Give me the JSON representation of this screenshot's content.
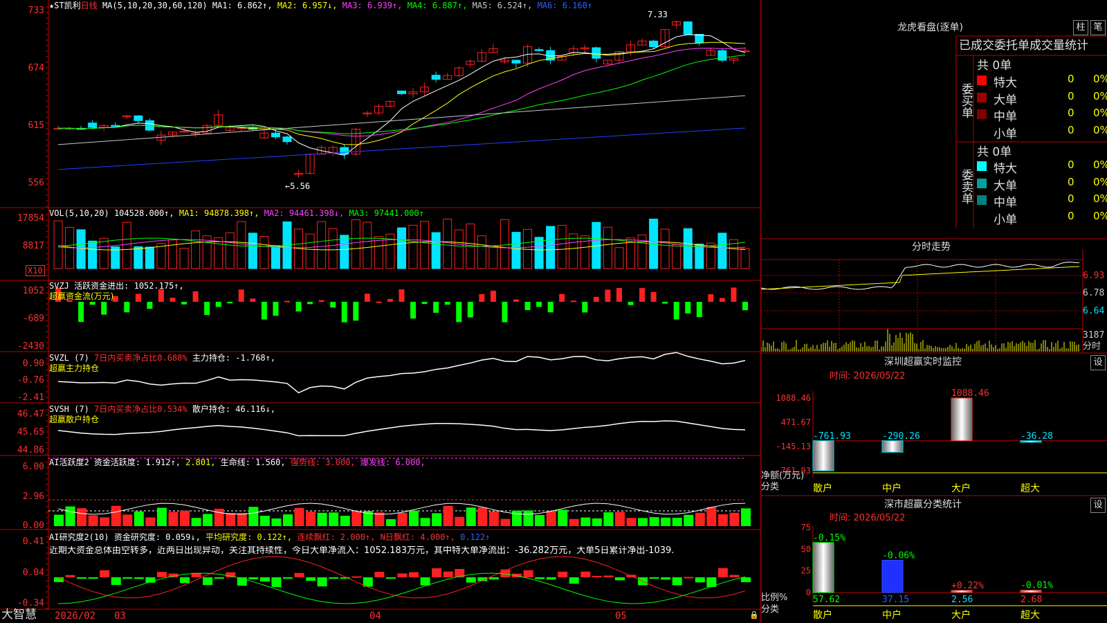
{
  "colors": {
    "up": "#ff2020",
    "down": "#00e5ff",
    "grid": "#b00000",
    "ma1": "#ffffff",
    "ma2": "#ffff00",
    "ma3": "#ff40ff",
    "ma4": "#00ff00",
    "ma5": "#c8c8c8",
    "ma6": "#2040ff"
  },
  "kline": {
    "header": {
      "name": "★ST凯利",
      "period": "日线",
      "ma_params": "MA(5,10,20,30,60,120)",
      "ma1": "MA1: 6.862↑,",
      "ma2": "MA2: 6.957↓,",
      "ma3": "MA3: 6.939↑,",
      "ma4": "MA4: 6.887↑,",
      "ma5": "MA5: 6.524↑,",
      "ma6": "MA6: 6.160↑"
    },
    "y_ticks": [
      "733",
      "674",
      "615",
      "556"
    ],
    "high_label": "7.33",
    "low_label": "←5.56"
  },
  "volume": {
    "header": {
      "title": "VOL(5,10,20)",
      "value": "104528.000↑,",
      "ma1": "MA1: 94878.398↑,",
      "ma2": "MA2: 94461.398↓,",
      "ma3": "MA3: 97441.000↑"
    },
    "y_ticks": [
      "17854",
      "8817"
    ],
    "unit": "X10"
  },
  "svzj": {
    "header": {
      "title": "SVZJ",
      "label": "活跃资金进出: 1052.175↑,",
      "sub": "超赢资金流(万元)"
    },
    "y_ticks": [
      "1052",
      "-689",
      "-2430"
    ]
  },
  "svzl": {
    "header": {
      "title": "SVZL (7)",
      "ratio": "7日内买卖净占比0.688%",
      "hold": "主力持仓: -1.768↑,",
      "sub": "超赢主力持仓"
    },
    "y_ticks": [
      "0.90",
      "-0.76",
      "-2.41"
    ]
  },
  "svsh": {
    "header": {
      "title": "SVSH (7)",
      "ratio": "7日内买卖净占比0.534%",
      "hold": "散户持仓: 46.116↓,",
      "sub": "超赢散户持仓"
    },
    "y_ticks": [
      "46.47",
      "45.65",
      "44.86"
    ]
  },
  "ai_active": {
    "header": {
      "title": "AI活跃度2",
      "a": "资金活跃度: 1.912↑,",
      "b": "2.801,",
      "c": "生命线: 1.560,",
      "d": "强势线: 3.000,",
      "e": "爆发线: 6.000,"
    },
    "y_ticks": [
      "6.00",
      "2.96",
      "0.00"
    ]
  },
  "ai_research": {
    "header": {
      "title": "AI研究度2(10)",
      "a": "资金研究度: 0.059↓,",
      "b": "平均研究度: 0.122↑,",
      "c": "连续飘红: 2.000↑,",
      "d": "N日飘红: 4.000↑,",
      "e": "0.122↑"
    },
    "note": "近期大资金总体由空转多，近两日出现异动，关注其持续性，今日大单净流入：1052.183万元，其中特大单净流出：-36.282万元，大单5日累计净出-1039.",
    "y_ticks": [
      "0.41",
      "0.04",
      "-0.34"
    ]
  },
  "bottom_bar": {
    "brand": "大智慧",
    "year": "2026/02",
    "months": [
      "03",
      "04",
      "05"
    ]
  },
  "dragon": {
    "title": "龙虎看盘(逐单)",
    "btn1": "柱",
    "btn2": "笔",
    "tabs": "已成交委托单成交量统计",
    "buy": {
      "side": "委买单",
      "total": "共 0单",
      "rows": [
        {
          "label": "特大",
          "v": "0",
          "p": "0%",
          "color": "#ff0000"
        },
        {
          "label": "大单",
          "v": "0",
          "p": "0%",
          "color": "#a00000"
        },
        {
          "label": "中单",
          "v": "0",
          "p": "0%",
          "color": "#800000"
        },
        {
          "label": "小单",
          "v": "0",
          "p": "0%",
          "color": ""
        }
      ]
    },
    "sell": {
      "side": "委卖单",
      "total": "共 0单",
      "rows": [
        {
          "label": "特大",
          "v": "0",
          "p": "0%",
          "color": "#00ffff"
        },
        {
          "label": "大单",
          "v": "0",
          "p": "0%",
          "color": "#00a0a0"
        },
        {
          "label": "中单",
          "v": "0",
          "p": "0%",
          "color": "#008080"
        },
        {
          "label": "小单",
          "v": "0",
          "p": "0%",
          "color": ""
        }
      ]
    }
  },
  "intraday": {
    "title": "分时走势",
    "prices": [
      "6.93",
      "6.78",
      "6.64"
    ],
    "vol": "3187",
    "unit": "分时"
  },
  "sz_monitor": {
    "title": "深圳超赢实时监控",
    "btn": "设",
    "time": "时间: 2026/05/22",
    "y_ticks": [
      "1088.46",
      "471.67",
      "-145.13",
      "-761.93"
    ],
    "ylabel": "净额(万元)",
    "xlabel": "分类",
    "bars": [
      {
        "label": "散户",
        "value": -761.93,
        "text": "-761.93"
      },
      {
        "label": "中户",
        "value": -290.26,
        "text": "-290.26"
      },
      {
        "label": "大户",
        "value": 1088.46,
        "text": "1088.46"
      },
      {
        "label": "超大",
        "value": -36.28,
        "text": "-36.28"
      }
    ]
  },
  "sz_class": {
    "title": "深市超赢分类统计",
    "btn": "设",
    "time": "时间: 2026/05/22",
    "y_ticks": [
      "75",
      "50",
      "25",
      "0"
    ],
    "ylabel": "比例%",
    "xlabel": "分类",
    "bars": [
      {
        "label": "散户",
        "value": 57.62,
        "text": "57.62",
        "chg": "-0.15%"
      },
      {
        "label": "中户",
        "value": 37.15,
        "text": "37.15",
        "chg": "-0.06%"
      },
      {
        "label": "大户",
        "value": 2.56,
        "text": "2.56",
        "chg": "+0.22%"
      },
      {
        "label": "超大",
        "value": 2.68,
        "text": "2.68",
        "chg": "-0.01%"
      }
    ]
  }
}
